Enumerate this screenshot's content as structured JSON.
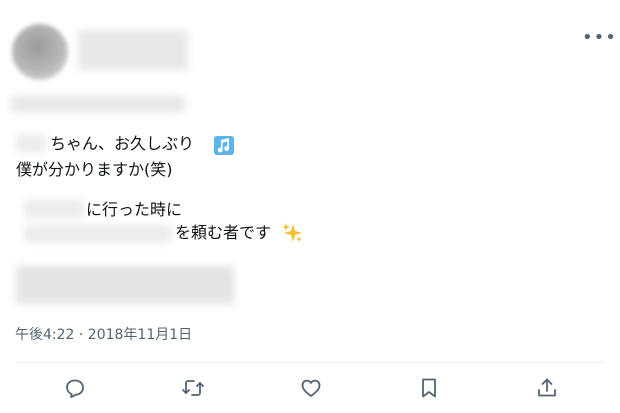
{
  "tweet": {
    "line1": "ちゃん、お久しぶり",
    "line2": "僕が分かりますか(笑)",
    "line3": "に行った時に",
    "line4": "を頼む者です",
    "timestamp": "午後4:22 · 2018年11月1日"
  },
  "icons": {
    "more": "more-horizontal-icon",
    "music_note": "musical-note-emoji",
    "sparkles": "sparkles-emoji",
    "reply": "reply-icon",
    "retweet": "retweet-icon",
    "like": "like-icon",
    "bookmark": "bookmark-icon",
    "share": "share-icon"
  },
  "colors": {
    "text": "#0f1419",
    "secondary": "#536471",
    "divider": "#eff3f4",
    "emoji_blue": "#5ab4e8",
    "emoji_gold": "#f5c22b"
  }
}
